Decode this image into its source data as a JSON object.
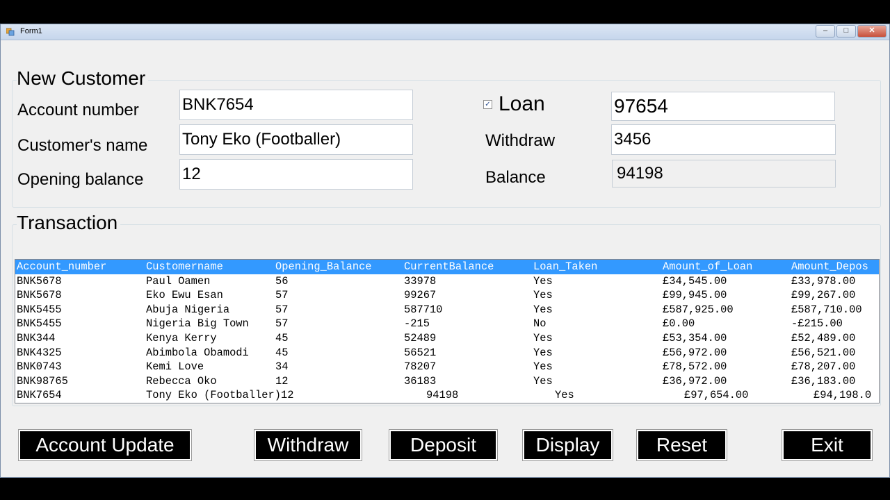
{
  "window": {
    "title": "Form1"
  },
  "new_customer": {
    "legend": "New Customer",
    "account_number_label": "Account number",
    "account_number_value": "BNK7654",
    "customer_name_label": "Customer's name",
    "customer_name_value": "Tony Eko (Footballer)",
    "opening_balance_label": "Opening balance",
    "opening_balance_value": "12",
    "loan_label": "Loan",
    "loan_checked": true,
    "loan_value": "97654",
    "withdraw_label": "Withdraw",
    "withdraw_value": "3456",
    "balance_label": "Balance",
    "balance_value": "94198"
  },
  "transaction": {
    "legend": "Transaction",
    "columns": [
      "Account_number",
      "Customername",
      "Opening_Balance",
      "CurrentBalance",
      "Loan_Taken",
      "Amount_of_Loan",
      "Amount_Depos"
    ],
    "rows": [
      [
        "BNK5678",
        "Paul Oamen",
        "56",
        "33978",
        "Yes",
        "£34,545.00",
        "£33,978.00"
      ],
      [
        "BNK5678",
        "Eko Ewu Esan",
        "57",
        "99267",
        "Yes",
        "£99,945.00",
        "£99,267.00"
      ],
      [
        "BNK5455",
        "Abuja Nigeria",
        "57",
        "587710",
        "Yes",
        "£587,925.00",
        "£587,710.00"
      ],
      [
        "BNK5455",
        "Nigeria Big Town",
        "57",
        "-215",
        "No",
        "£0.00",
        "-£215.00"
      ],
      [
        "BNK344",
        "Kenya Kerry",
        "45",
        "52489",
        "Yes",
        "£53,354.00",
        "£52,489.00"
      ],
      [
        "BNK4325",
        "Abimbola Obamodi",
        "45",
        "56521",
        "Yes",
        "£56,972.00",
        "£56,521.00"
      ],
      [
        "BNK0743",
        "Kemi Love",
        "34",
        "78207",
        "Yes",
        "£78,572.00",
        "£78,207.00"
      ],
      [
        "BNK98765",
        "Rebecca Oko",
        "12",
        "36183",
        "Yes",
        "£36,972.00",
        "£36,183.00"
      ]
    ],
    "last_row": [
      "BNK7654",
      "Tony Eko (Footballer)12",
      "94198",
      "Yes",
      "£97,654.00",
      "£94,198.0"
    ]
  },
  "buttons": {
    "account_update": "Account Update",
    "withdraw": "Withdraw",
    "deposit": "Deposit",
    "display": "Display",
    "reset": "Reset",
    "exit": "Exit"
  }
}
